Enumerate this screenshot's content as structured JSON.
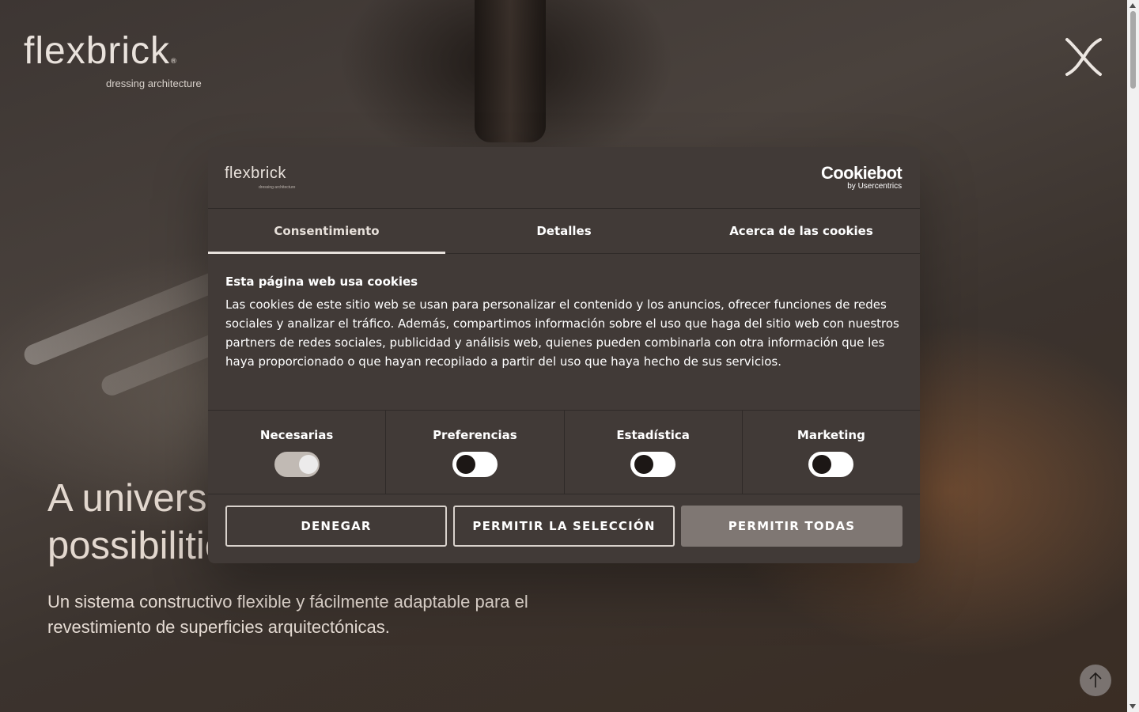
{
  "site": {
    "logo_word": "flexbrick",
    "logo_reg": "®",
    "logo_tagline": "dressing architecture"
  },
  "hero": {
    "title_line1": "A universe of",
    "title_line2": "possibilities",
    "subtitle": "Un sistema constructivo flexible y fácilmente adaptable para el revestimiento de superficies arquitectónicas."
  },
  "cookie_dialog": {
    "logo_word": "flexbrick",
    "logo_tagline": "dressing architecture",
    "provider_main": "Cookiebot",
    "provider_by": "by Usercentrics",
    "tabs": [
      {
        "label": "Consentimiento",
        "active": true
      },
      {
        "label": "Detalles",
        "active": false
      },
      {
        "label": "Acerca de las cookies",
        "active": false
      }
    ],
    "heading": "Esta página web usa cookies",
    "body": "Las cookies de este sitio web se usan para personalizar el contenido y los anuncios, ofrecer funciones de redes sociales y analizar el tráfico. Además, compartimos información sobre el uso que haga del sitio web con nuestros partners de redes sociales, publicidad y análisis web, quienes pueden combinarla con otra información que les haya proporcionado o que hayan recopilado a partir del uso que haya hecho de sus servicios.",
    "categories": [
      {
        "label": "Necesarias",
        "enabled": true,
        "locked": true
      },
      {
        "label": "Preferencias",
        "enabled": false
      },
      {
        "label": "Estadística",
        "enabled": false
      },
      {
        "label": "Marketing",
        "enabled": false
      }
    ],
    "buttons": {
      "deny": "DENEGAR",
      "allow_selection": "PERMITIR LA SELECCIÓN",
      "allow_all": "PERMITIR TODAS"
    }
  },
  "colors": {
    "dialog_bg": "#413a37",
    "primary_button": "#7f7773",
    "hero_text": "#e3d8cf"
  },
  "icons": {
    "menu": "close-x-icon",
    "scroll_top": "arrow-up-icon"
  }
}
